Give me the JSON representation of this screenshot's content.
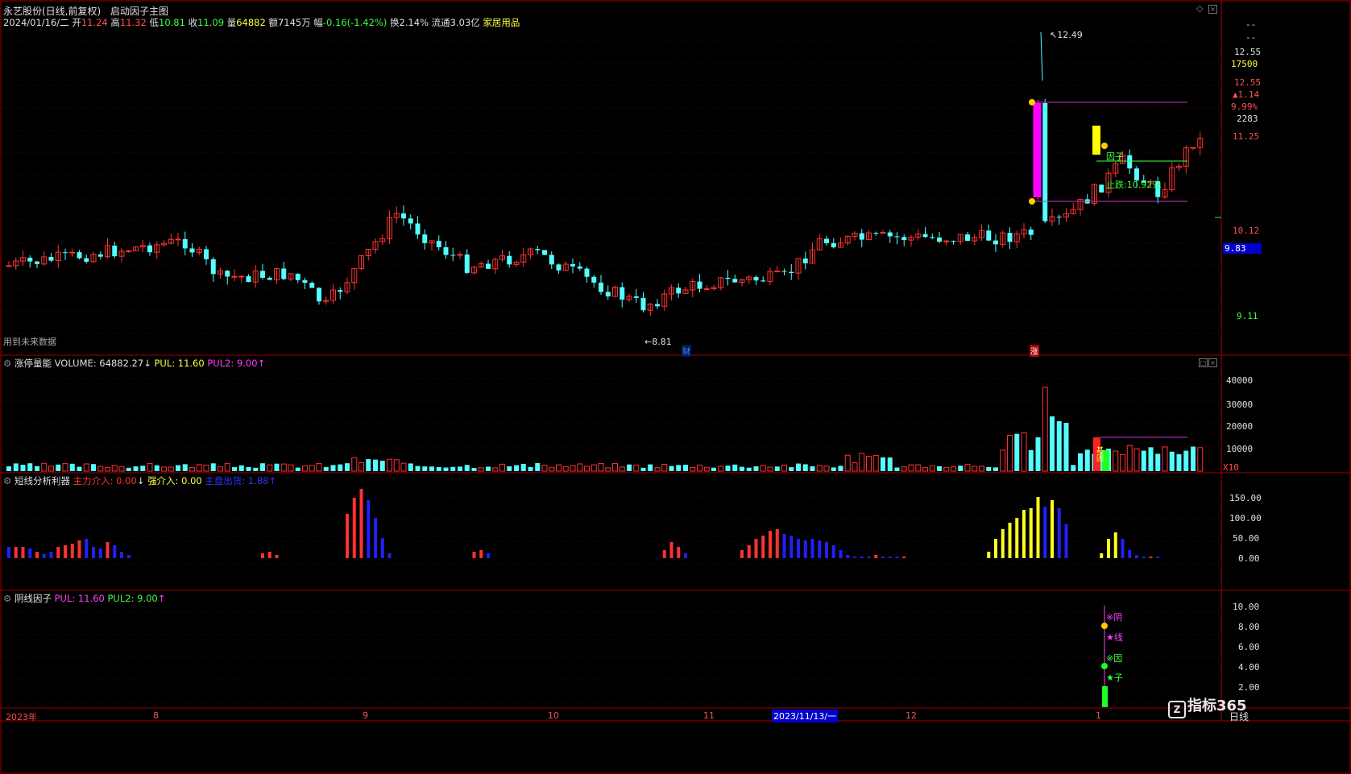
{
  "header": {
    "stock": "永艺股份(日线,前复权)",
    "indicator": "启动因子主图",
    "date": "2024/01/16/二",
    "open_label": "开",
    "open": "11.24",
    "high_label": "高",
    "high": "11.32",
    "low_label": "低",
    "low": "10.81",
    "close_label": "收",
    "close": "11.09",
    "vol_label": "量",
    "vol": "64882",
    "amt_label": "额",
    "amt": "7145万",
    "chg_label": "幅",
    "chg": "-0.16(-1.42%)",
    "turn_label": "换",
    "turn": "2.14%",
    "float_label": "流通",
    "float": "3.03亿",
    "sector": "家居用品"
  },
  "main": {
    "future_note": "用到未来数据",
    "hi_mark": "12.49",
    "lo_mark": "8.81",
    "cai_badge": "财",
    "zhang_badge": "涨",
    "factor_label": "因子",
    "stop_label": "止跌:10.92元",
    "price_axis": [
      "12.55",
      "17500",
      "12.55",
      "▲1.14",
      "9.99%",
      "2283",
      "11.25",
      "10.12",
      "9.11"
    ],
    "price_axis_top": [
      "--",
      "--"
    ],
    "cursor_price": "9.83"
  },
  "vol_panel": {
    "name": "涨停量能",
    "vol_text": "VOLUME: 64882.27",
    "pul": "PUL: 11.60",
    "pul2": "PUL2: 9.00",
    "axis": [
      "40000",
      "30000",
      "20000",
      "10000"
    ],
    "unit": "X10",
    "tag": "基因"
  },
  "short_panel": {
    "name": "短线分析利器",
    "main_in": "主力介入: 0.00",
    "strong_in": "强介入: 0.00",
    "main_out": "主盘出货: 1.88",
    "axis": [
      "150.00",
      "100.00",
      "50.00",
      "0.00"
    ]
  },
  "yin_panel": {
    "name": "阴线因子",
    "pul": "PUL: 11.60",
    "pul2": "PUL2: 9.00",
    "axis": [
      "10.00",
      "8.00",
      "6.00",
      "4.00",
      "2.00"
    ],
    "labels": [
      "※阴",
      "★线",
      "※因",
      "★子"
    ]
  },
  "time_axis": [
    "2023年",
    "8",
    "9",
    "10",
    "11",
    "2023/11/13/一",
    "12",
    "1"
  ],
  "period": "日线",
  "watermark": "指标365",
  "colors": {
    "up": "#ff3232",
    "down": "#54ffff",
    "bg": "#000000",
    "grid": "#a00000"
  }
}
